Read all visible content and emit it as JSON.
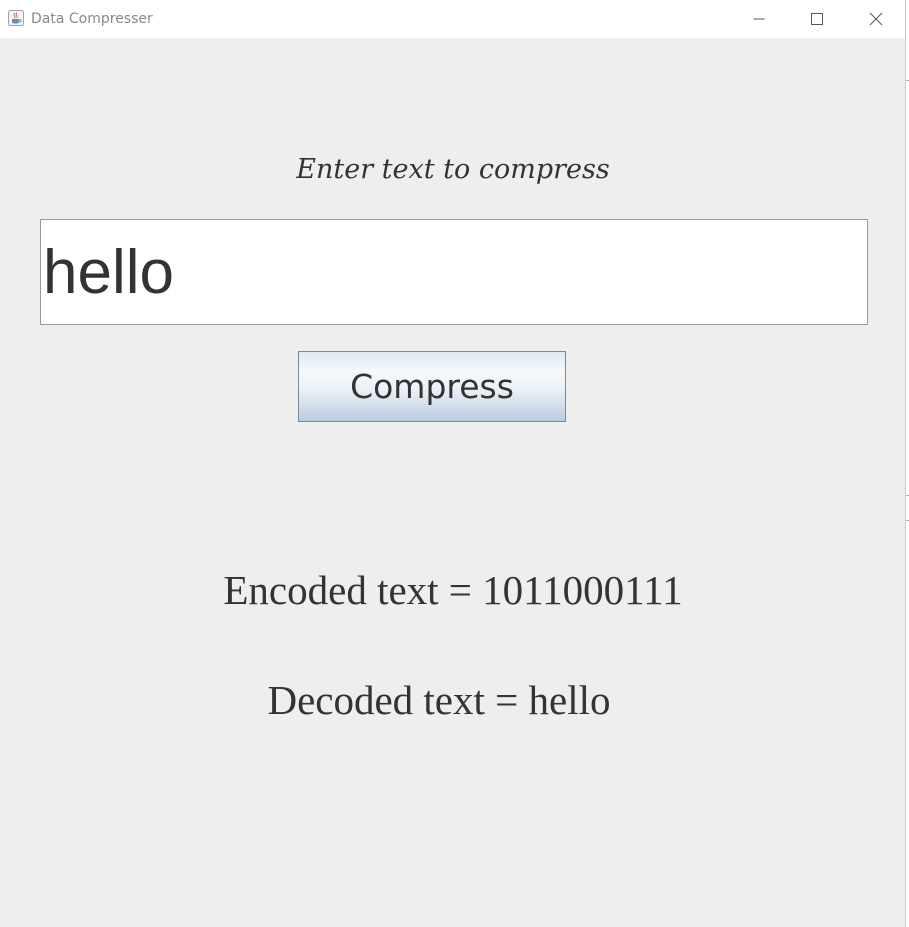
{
  "window": {
    "title": "Data Compresser",
    "app_icon": "java-cup-icon",
    "controls": {
      "minimize_icon": "minimize-icon",
      "maximize_icon": "maximize-icon",
      "close_icon": "close-icon"
    }
  },
  "form": {
    "prompt": "Enter text to compress",
    "input_value": "hello",
    "compress_label": "Compress"
  },
  "results": {
    "encoded": "Encoded text = 1011000111",
    "decoded": "Decoded text = hello"
  },
  "colors": {
    "background": "#eeeeee",
    "text": "#333333",
    "button_gradient_top": "#f6f9fc",
    "button_gradient_bottom": "#b9cde0"
  }
}
